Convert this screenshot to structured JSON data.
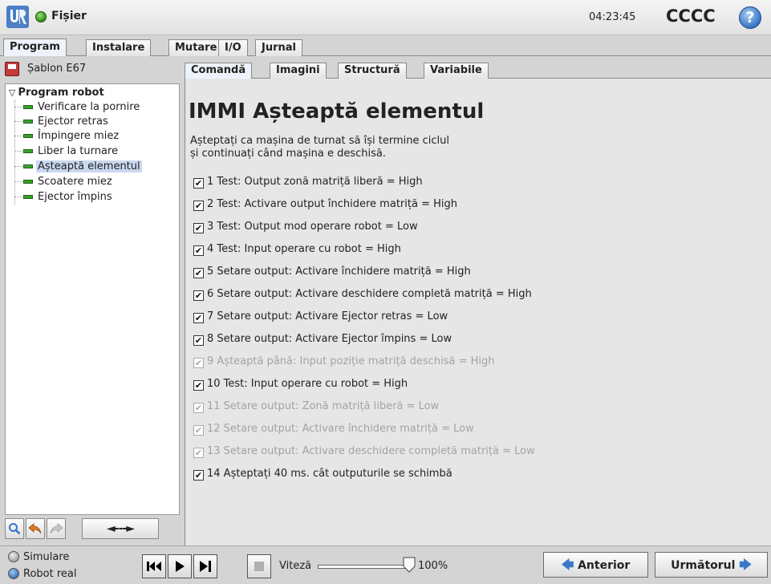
{
  "titlebar": {
    "file_menu": "Fișier",
    "clock": "04:23:45",
    "robot_name": "CCCC",
    "help_glyph": "?"
  },
  "main_tabs": [
    {
      "label": "Program",
      "active": true
    },
    {
      "label": "Instalare",
      "active": false
    },
    {
      "label": "Mutare",
      "active": false
    },
    {
      "label": "I/O",
      "active": false
    },
    {
      "label": "Jurnal",
      "active": false
    }
  ],
  "left": {
    "template_label": "Șablon E67",
    "tree_root": "Program robot",
    "nodes": [
      {
        "label": "Verificare la pornire"
      },
      {
        "label": "Ejector retras"
      },
      {
        "label": "Împingere miez"
      },
      {
        "label": "Liber la turnare"
      },
      {
        "label": "Așteaptă elementul",
        "selected": true
      },
      {
        "label": "Scoatere miez"
      },
      {
        "label": "Ejector împins"
      }
    ],
    "tree_nav_label": "◄---►"
  },
  "sub_tabs": [
    {
      "label": "Comandă",
      "active": true
    },
    {
      "label": "Imagini",
      "active": false
    },
    {
      "label": "Structură",
      "active": false
    },
    {
      "label": "Variabile",
      "active": false
    }
  ],
  "content": {
    "heading": "IMMI Așteaptă elementul",
    "description_line1": "Așteptați ca mașina de turnat să își termine ciclul",
    "description_line2": "și continuați când mașina e deschisă.",
    "items": [
      {
        "text": "1 Test: Output zonă matriță liberă = High",
        "enabled": true
      },
      {
        "text": "2 Test: Activare output închidere matriță = High",
        "enabled": true
      },
      {
        "text": "3 Test: Output mod operare robot = Low",
        "enabled": true
      },
      {
        "text": "4 Test: Input operare cu robot = High",
        "enabled": true
      },
      {
        "text": "5 Setare output: Activare închidere matriță = High",
        "enabled": true
      },
      {
        "text": "6 Setare output: Activare deschidere completă matriță = High",
        "enabled": true
      },
      {
        "text": "7 Setare output: Activare Ejector retras = Low",
        "enabled": true
      },
      {
        "text": "8 Setare output: Activare Ejector împins = Low",
        "enabled": true
      },
      {
        "text": "9 Așteaptă până: Input poziție matriță deschisă = High",
        "enabled": false
      },
      {
        "text": "10 Test: Input operare cu robot = High",
        "enabled": true
      },
      {
        "text": "11 Setare output: Zonă matriță liberă = Low",
        "enabled": false
      },
      {
        "text": "12 Setare output: Activare închidere matriță = Low",
        "enabled": false
      },
      {
        "text": "13 Setare output: Activare deschidere completă matriță = Low",
        "enabled": false
      },
      {
        "text": "14 Așteptați 40 ms. cât outputurile se schimbă",
        "enabled": true
      }
    ]
  },
  "bottom": {
    "mode_simulation": "Simulare",
    "mode_real": "Robot real",
    "speed_label": "Viteză",
    "speed_value": "100%",
    "speed_fraction": 1.0,
    "prev_label": "Anterior",
    "next_label": "Următorul"
  },
  "colors": {
    "accent": "#3a76c9",
    "selection": "#c9d8f0",
    "node_green": "#3aa12c"
  }
}
